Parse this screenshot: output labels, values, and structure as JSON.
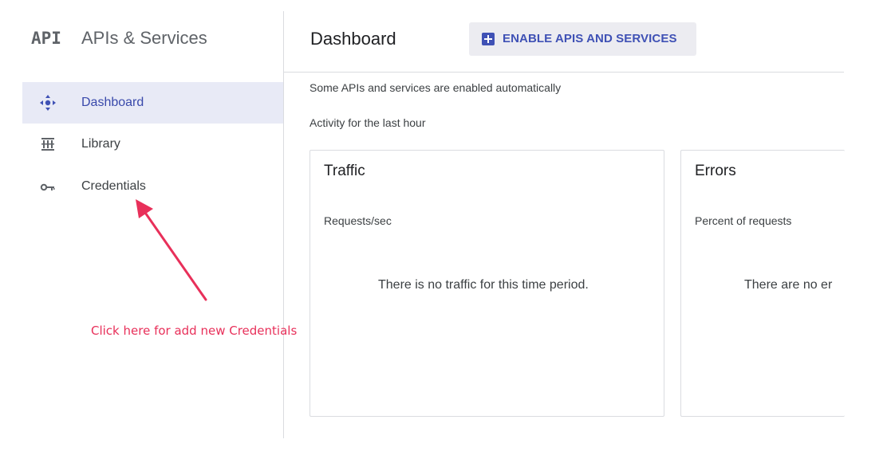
{
  "sidebar": {
    "logo_text": "API",
    "title": "APIs & Services",
    "items": [
      {
        "label": "Dashboard",
        "icon": "dashboard-icon",
        "active": true
      },
      {
        "label": "Library",
        "icon": "library-icon",
        "active": false
      },
      {
        "label": "Credentials",
        "icon": "key-icon",
        "active": false
      }
    ]
  },
  "header": {
    "title": "Dashboard",
    "enable_button_label": "ENABLE APIS AND SERVICES",
    "enable_button_icon": "plus-box-icon"
  },
  "main": {
    "notice": "Some APIs and services are enabled automatically",
    "activity_label": "Activity for the last hour",
    "cards": [
      {
        "title": "Traffic",
        "subtitle": "Requests/sec",
        "empty_message": "There is no traffic for this time period."
      },
      {
        "title": "Errors",
        "subtitle": "Percent of requests",
        "empty_message": "There are no er"
      }
    ]
  },
  "annotation": {
    "text": "Click here for add new Credentials",
    "color": "#e8305a"
  },
  "colors": {
    "accent": "#3f51b5",
    "active_bg": "#e8eaf6",
    "divider": "#dadce0"
  }
}
